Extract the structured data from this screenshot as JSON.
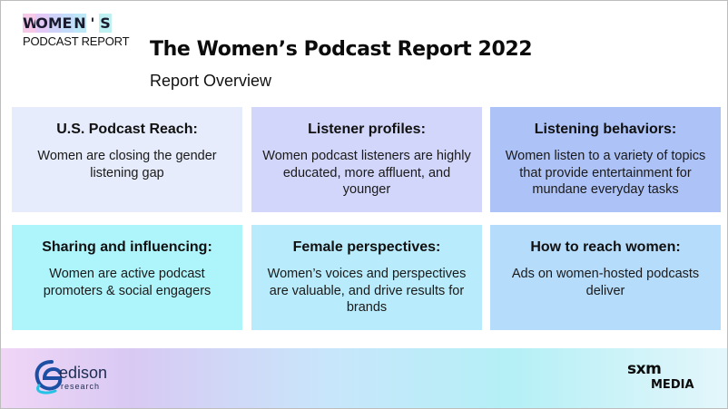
{
  "logo": {
    "letters": [
      "W",
      "O",
      "M",
      "E",
      "N",
      "'",
      "S"
    ],
    "letter_colors": [
      "#f6c9e8",
      "#e3c9f6",
      "#cfd3f9",
      "#c3dcfa",
      "#bde7f7",
      "#ffffff",
      "#bff1f3"
    ],
    "subtitle": "PODCAST REPORT"
  },
  "header": {
    "title": "The Women’s Podcast Report 2022",
    "subtitle": "Report Overview"
  },
  "cards": [
    {
      "heading": "U.S. Podcast Reach:",
      "body": "Women are closing the gender listening gap"
    },
    {
      "heading": "Listener profiles:",
      "body": "Women podcast listeners are highly educated, more affluent, and younger"
    },
    {
      "heading": "Listening behaviors:",
      "body": "Women listen to a variety of topics that provide entertainment for mundane everyday tasks"
    },
    {
      "heading": "Sharing and influencing:",
      "body": "Women are active podcast promoters & social engagers"
    },
    {
      "heading": "Female perspectives:",
      "body": "Women’s voices and perspectives are valuable, and drive results for brands"
    },
    {
      "heading": "How to reach women:",
      "body": "Ads on women-hosted podcasts deliver"
    }
  ],
  "footer": {
    "edison_logo": {
      "name": "edison",
      "tagline": "research"
    },
    "sxm_logo": {
      "line1": "sxm",
      "line2": "MEDIA"
    }
  }
}
